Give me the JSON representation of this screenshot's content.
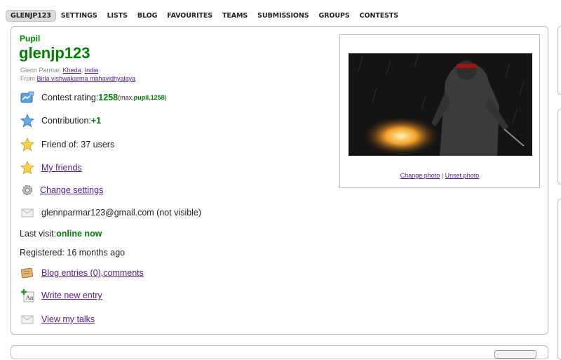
{
  "nav": {
    "items": [
      "GLENJP123",
      "SETTINGS",
      "LISTS",
      "BLOG",
      "FAVOURITES",
      "TEAMS",
      "SUBMISSIONS",
      "GROUPS",
      "CONTESTS"
    ]
  },
  "profile": {
    "rank": "Pupil",
    "handle": "glenjp123",
    "name_prefix": "Glenn Parmar, ",
    "city": "Kheda",
    "sep": ", ",
    "country": "India",
    "from_prefix": "From ",
    "organization": "Birla vishwakarma mahavidhyalaya"
  },
  "stats": {
    "rating_label": "Contest rating: ",
    "rating": "1258",
    "max_prefix": " (max. ",
    "max_rank": "pupil",
    "max_sep": ", ",
    "max_value": "1258",
    "max_suffix": ")",
    "contribution_label": "Contribution: ",
    "contribution": "+1",
    "friend_of": "Friend of: 37 users",
    "my_friends": "My friends",
    "change_settings": "Change settings",
    "email": "glennparmar123@gmail.com (not visible)",
    "last_visit_label": "Last visit: ",
    "last_visit": "online now",
    "registered": "Registered: 16 months ago",
    "blog_entries": "Blog entries (0)",
    "comma": ", ",
    "comments": "comments",
    "write_entry": "Write new entry",
    "view_talks": "View my talks"
  },
  "photo": {
    "change": "Change photo",
    "divider": " | ",
    "unset": "Unset photo"
  },
  "colors": {
    "pupil_green": "#008000",
    "link_purple": "#551a8b"
  }
}
